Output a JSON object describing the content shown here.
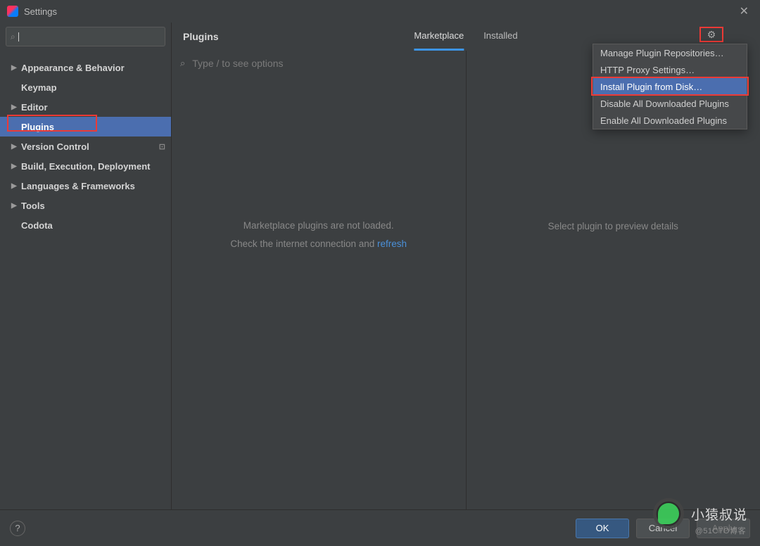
{
  "window": {
    "title": "Settings"
  },
  "sidebar": {
    "search_placeholder": "",
    "items": [
      {
        "label": "Appearance & Behavior",
        "expandable": true
      },
      {
        "label": "Keymap",
        "expandable": false
      },
      {
        "label": "Editor",
        "expandable": true
      },
      {
        "label": "Plugins",
        "expandable": false,
        "selected": true
      },
      {
        "label": "Version Control",
        "expandable": true,
        "badge": "⊡"
      },
      {
        "label": "Build, Execution, Deployment",
        "expandable": true
      },
      {
        "label": "Languages & Frameworks",
        "expandable": true
      },
      {
        "label": "Tools",
        "expandable": true
      },
      {
        "label": "Codota",
        "expandable": false
      }
    ]
  },
  "main": {
    "heading": "Plugins",
    "tabs": [
      {
        "label": "Marketplace",
        "active": true
      },
      {
        "label": "Installed",
        "active": false
      }
    ],
    "search_placeholder": "Type / to see options",
    "placeholder_line1": "Marketplace plugins are not loaded.",
    "placeholder_line2a": "Check the internet connection and ",
    "placeholder_line2b": "refresh",
    "preview_msg": "Select plugin to preview details"
  },
  "gear_menu": {
    "items": [
      {
        "label": "Manage Plugin Repositories…"
      },
      {
        "label": "HTTP Proxy Settings…"
      },
      {
        "label": "Install Plugin from Disk…",
        "highlight": true
      },
      {
        "label": "Disable All Downloaded Plugins"
      },
      {
        "label": "Enable All Downloaded Plugins"
      }
    ]
  },
  "footer": {
    "ok": "OK",
    "cancel": "Cancel",
    "apply": "Apply"
  },
  "watermark": {
    "text": "小猿叔说",
    "sub": "@51CTO博客"
  }
}
